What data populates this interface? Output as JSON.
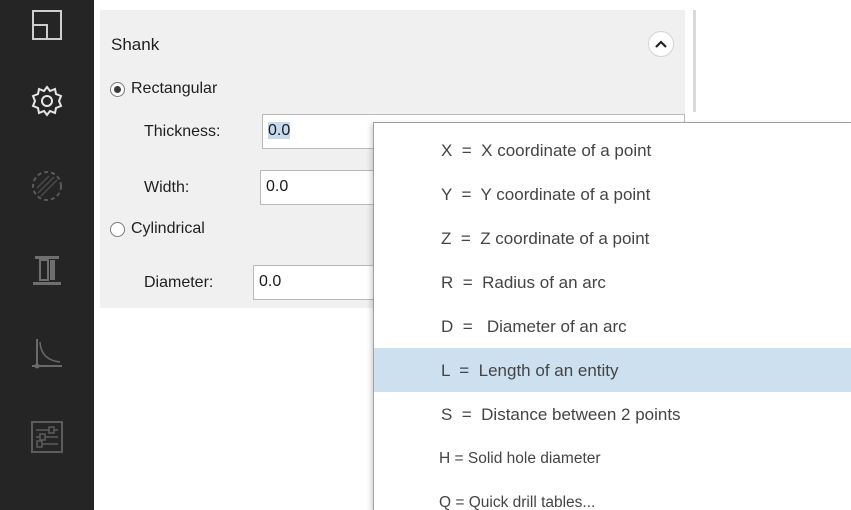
{
  "toolbar": {
    "items": [
      {
        "icon": "layout-icon"
      },
      {
        "icon": "gear-icon"
      },
      {
        "icon": "circle-pattern-icon"
      },
      {
        "icon": "tool-holder-icon"
      },
      {
        "icon": "curve-axis-icon"
      },
      {
        "icon": "sliders-panel-icon"
      }
    ]
  },
  "panel": {
    "title": "Shank",
    "rectangular": {
      "label": "Rectangular",
      "selected": true,
      "thickness_label": "Thickness:",
      "thickness_value": "0.0",
      "width_label": "Width:",
      "width_value": "0.0"
    },
    "cylindrical": {
      "label": "Cylindrical",
      "selected": false,
      "diameter_label": "Diameter:",
      "diameter_value": "0.0"
    }
  },
  "menu": {
    "items": [
      {
        "label": "X  =  X coordinate of a point"
      },
      {
        "label": "Y  =  Y coordinate of a point"
      },
      {
        "label": "Z  =  Z coordinate of a point"
      },
      {
        "label": "R  =  Radius of an arc"
      },
      {
        "label": "D  =   Diameter of an arc"
      },
      {
        "label": "L  =  Length of an entity"
      },
      {
        "label": "S  =  Distance between 2 points"
      },
      {
        "label": "H = Solid hole diameter"
      },
      {
        "label": "Q = Quick drill tables..."
      }
    ],
    "highlighted_index": 5
  },
  "colors": {
    "toolbar_bg": "#252526",
    "panel_bg": "#f0f0f0",
    "highlight": "#cde0f0",
    "selection": "#c7d9ee"
  }
}
